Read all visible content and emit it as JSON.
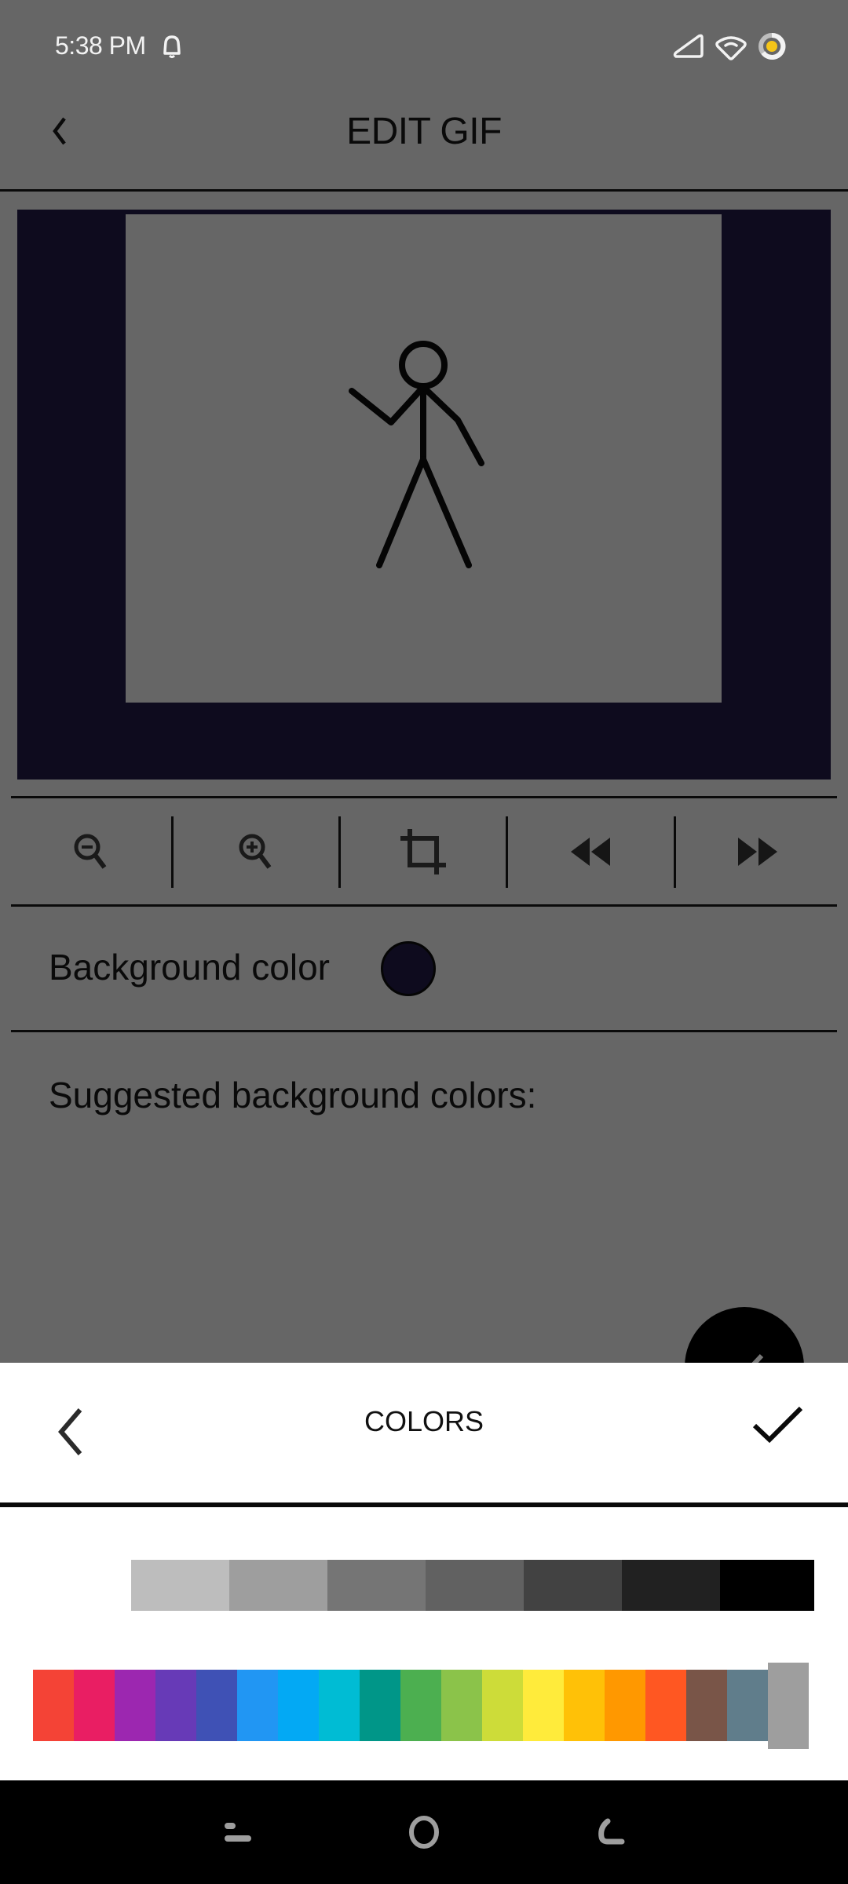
{
  "status_bar": {
    "time": "5:38 PM",
    "icons": [
      "notification-bell-icon",
      "signal-icon",
      "wifi-icon",
      "battery-icon"
    ]
  },
  "header": {
    "title": "EDIT GIF",
    "back_icon": "back-chevron-icon"
  },
  "preview": {
    "background_color": "#0e0b1e",
    "frame_color": "#666666",
    "content": "stick figure"
  },
  "toolbar": {
    "buttons": [
      {
        "name": "zoom-out",
        "icon": "zoom-out-icon"
      },
      {
        "name": "zoom-in",
        "icon": "zoom-in-icon"
      },
      {
        "name": "crop",
        "icon": "crop-icon"
      },
      {
        "name": "previous-frame",
        "icon": "rewind-icon"
      },
      {
        "name": "next-frame",
        "icon": "fast-forward-icon"
      }
    ]
  },
  "background_color": {
    "label": "Background color",
    "value": "#0e0b1e"
  },
  "suggested": {
    "label": "Suggested background colors:"
  },
  "fab": {
    "icon": "check-icon"
  },
  "colors_sheet": {
    "title": "COLORS",
    "back_icon": "back-chevron-icon",
    "confirm_icon": "check-icon",
    "gray_swatches": [
      "#FFFFFF",
      "#BDBDBD",
      "#9E9E9E",
      "#757575",
      "#616161",
      "#424242",
      "#212121",
      "#000000"
    ],
    "color_swatches": [
      "#F44336",
      "#E91E63",
      "#9C27B0",
      "#673AB7",
      "#3F51B5",
      "#2196F3",
      "#03A9F4",
      "#00BCD4",
      "#009688",
      "#4CAF50",
      "#8BC34A",
      "#CDDC39",
      "#FFEB3B",
      "#FFC107",
      "#FF9800",
      "#FF5722",
      "#795548",
      "#607D8B",
      "#9E9E9E"
    ],
    "selected_color": "#9E9E9E"
  },
  "nav_bar": {
    "icons": [
      "recents-icon",
      "home-icon",
      "back-icon"
    ]
  }
}
